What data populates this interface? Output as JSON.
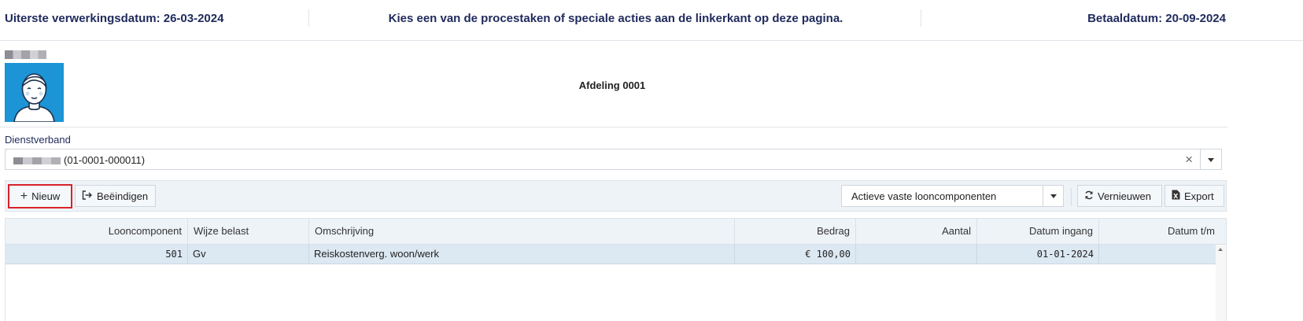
{
  "header": {
    "deadline": "Uiterste verwerkingsdatum: 26-03-2024",
    "instruction": "Kies een van de procestaken of speciale acties aan de linkerkant op deze pagina.",
    "pay_date": "Betaaldatum: 20-09-2024"
  },
  "employee": {
    "avatar_icon": "user-avatar-icon",
    "department": "Afdeling 0001"
  },
  "dienstverband": {
    "label": "Dienstverband",
    "value_suffix": "(01-0001-000011)",
    "clear_icon": "×"
  },
  "toolbar": {
    "new_label": "Nieuw",
    "new_icon": "+",
    "end_label": "Beëindigen",
    "filter_value": "Actieve vaste looncomponenten",
    "refresh_label": "Vernieuwen",
    "export_label": "Export"
  },
  "grid": {
    "columns": [
      "Looncomponent",
      "Wijze belast",
      "Omschrijving",
      "Bedrag",
      "Aantal",
      "Datum ingang",
      "Datum t/m"
    ],
    "rows": [
      {
        "looncomponent": "501",
        "wijze_belast": "Gv",
        "omschrijving": "Reiskostenverg. woon/werk",
        "bedrag": "€ 100,00",
        "aantal": "",
        "datum_ingang": "01-01-2024",
        "datum_tm": ""
      }
    ]
  },
  "colors": {
    "accent_text": "#1f2a5c",
    "avatar_bg": "#1c94d6",
    "highlight_border": "#d9222a",
    "row_selected": "#dce8f2"
  }
}
